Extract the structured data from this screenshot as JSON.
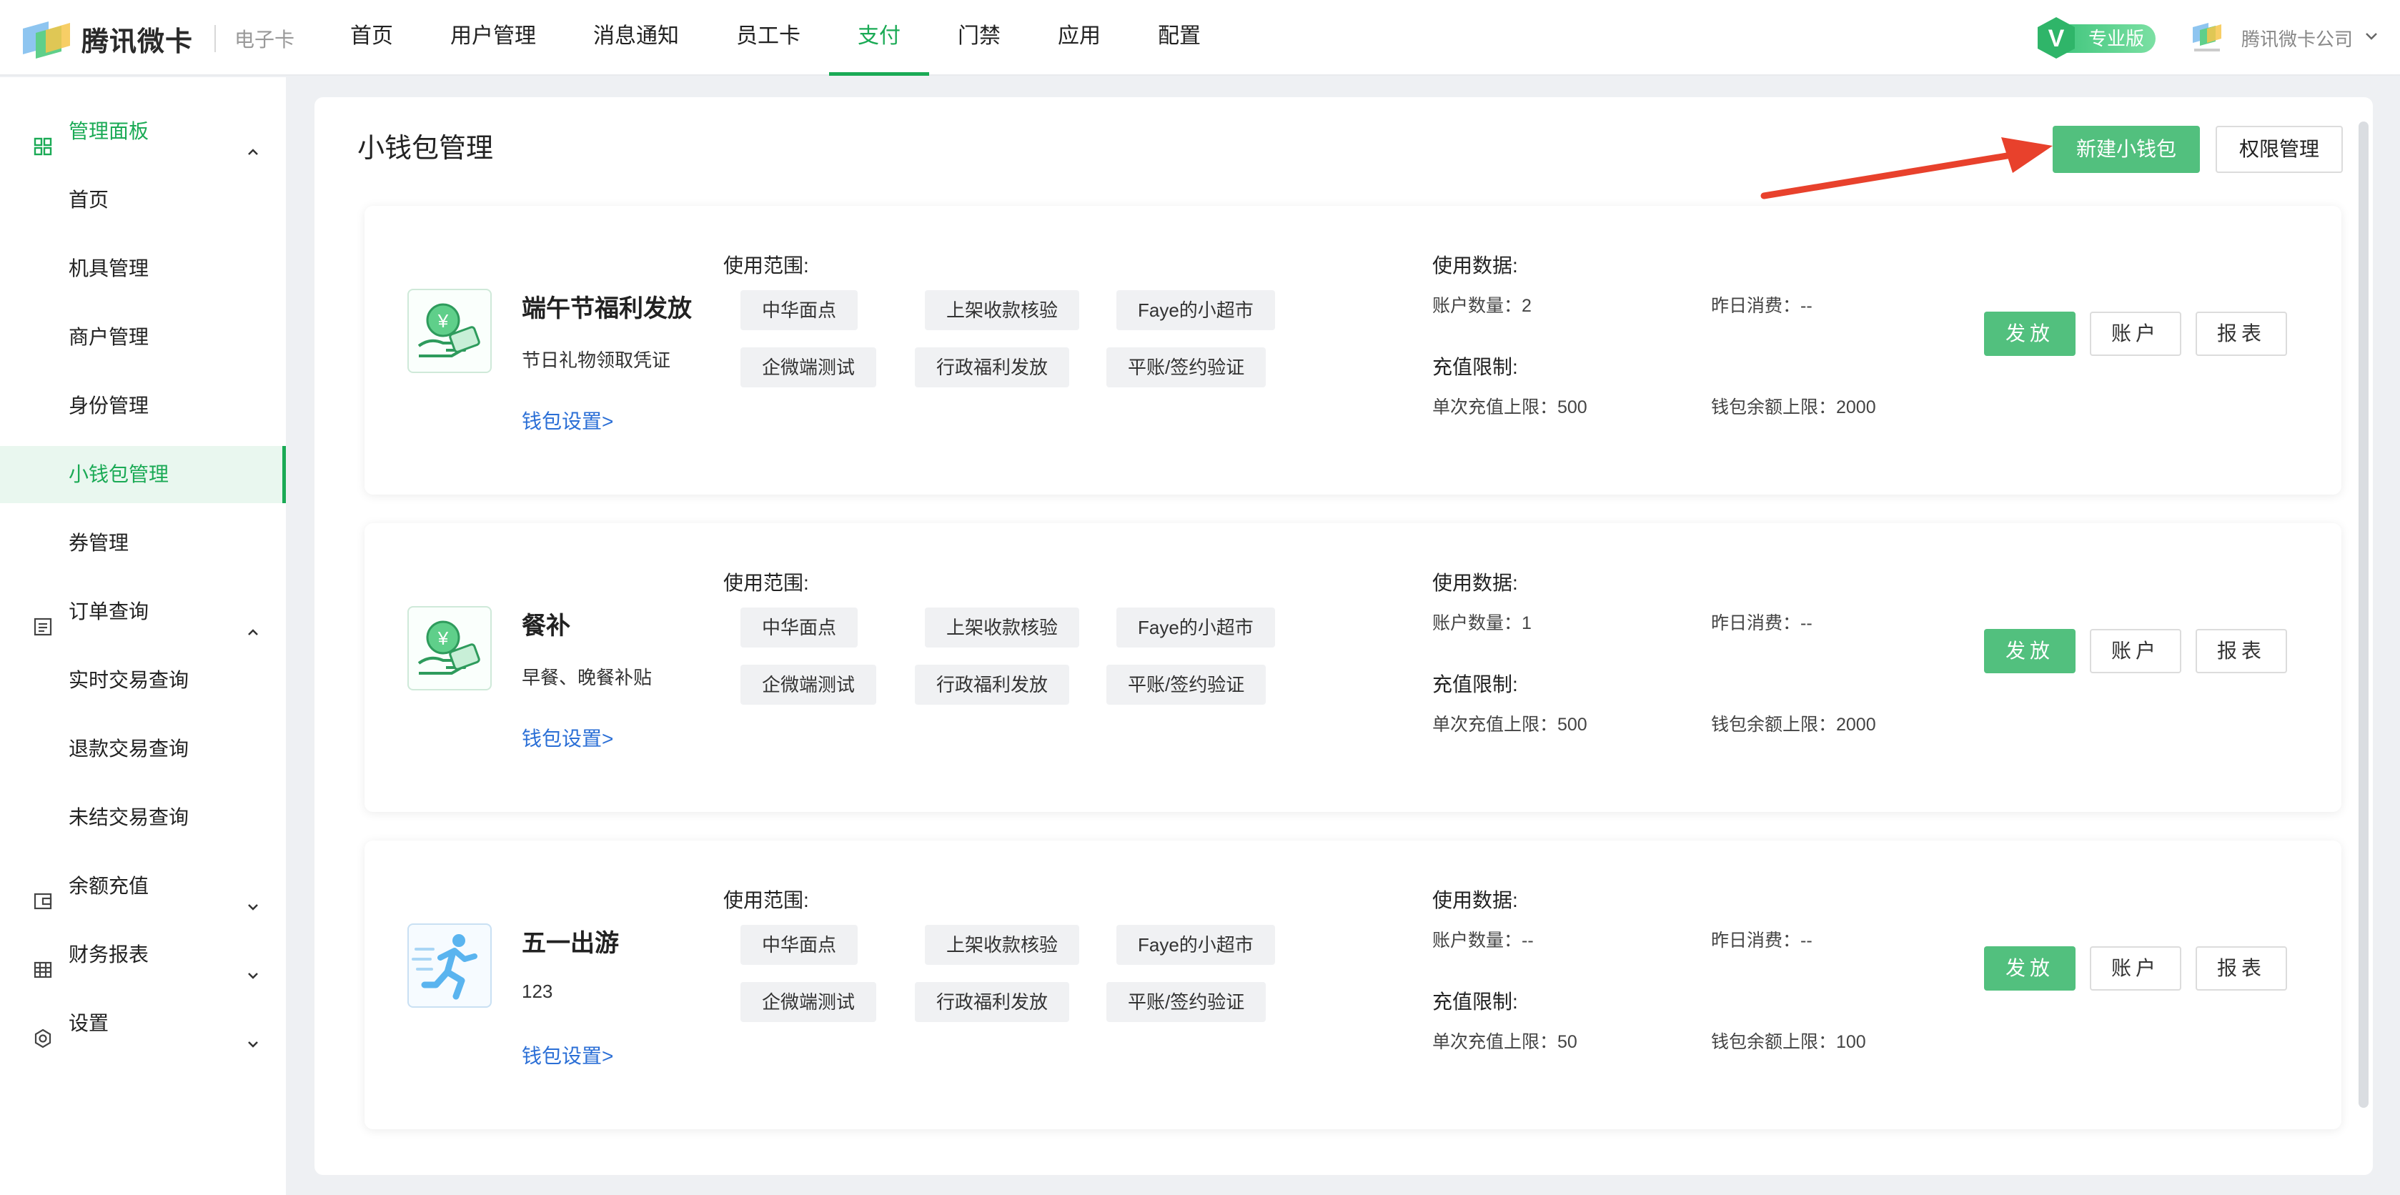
{
  "topbar": {
    "logo_text": "腾讯微卡",
    "logo_sub": "电子卡",
    "nav": [
      "首页",
      "用户管理",
      "消息通知",
      "员工卡",
      "支付",
      "门禁",
      "应用",
      "配置"
    ],
    "active_nav": "支付",
    "pro_label": "专业版",
    "pro_v": "V",
    "company": "腾讯微卡公司"
  },
  "sidebar": {
    "groups": [
      {
        "label": "管理面板",
        "icon": "grid-icon",
        "expanded": true,
        "items": [
          "首页",
          "机具管理",
          "商户管理",
          "身份管理",
          "小钱包管理",
          "券管理"
        ]
      },
      {
        "label": "订单查询",
        "icon": "list-icon",
        "expanded": true,
        "items": [
          "实时交易查询",
          "退款交易查询",
          "未结交易查询"
        ]
      },
      {
        "label": "余额充值",
        "icon": "wallet-icon",
        "expanded": false,
        "items": []
      },
      {
        "label": "财务报表",
        "icon": "table-icon",
        "expanded": false,
        "items": []
      },
      {
        "label": "设置",
        "icon": "gear-icon",
        "expanded": false,
        "items": []
      }
    ],
    "active_item": "小钱包管理"
  },
  "main": {
    "title": "小钱包管理",
    "new_button": "新建小钱包",
    "perm_button": "权限管理",
    "scope_label": "使用范围:",
    "data_label": "使用数据:",
    "limit_label": "充值限制:",
    "actions": {
      "issue": "发放",
      "account": "账户",
      "report": "报表"
    },
    "wallets": [
      {
        "name": "端午节福利发放",
        "desc": "节日礼物领取凭证",
        "link": "钱包设置>",
        "icon": "money-hand-icon",
        "scopes": [
          "中华面点",
          "上架收款核验",
          "Faye的小超市",
          "企微端测试",
          "行政福利发放",
          "平账/签约验证"
        ],
        "account_count": "账户数量：2",
        "yesterday": "昨日消费：--",
        "single_limit": "单次充值上限：500",
        "balance_limit": "钱包余额上限：2000"
      },
      {
        "name": "餐补",
        "desc": "早餐、晚餐补贴",
        "link": "钱包设置>",
        "icon": "money-hand-icon",
        "scopes": [
          "中华面点",
          "上架收款核验",
          "Faye的小超市",
          "企微端测试",
          "行政福利发放",
          "平账/签约验证"
        ],
        "account_count": "账户数量：1",
        "yesterday": "昨日消费：--",
        "single_limit": "单次充值上限：500",
        "balance_limit": "钱包余额上限：2000"
      },
      {
        "name": "五一出游",
        "desc": "123",
        "link": "钱包设置>",
        "icon": "runner-icon",
        "scopes": [
          "中华面点",
          "上架收款核验",
          "Faye的小超市",
          "企微端测试",
          "行政福利发放",
          "平账/签约验证"
        ],
        "account_count": "账户数量：--",
        "yesterday": "昨日消费：--",
        "single_limit": "单次充值上限：50",
        "balance_limit": "钱包余额上限：100"
      }
    ]
  },
  "colors": {
    "accent": "#52c07e",
    "active_nav": "#1aaa55",
    "link": "#2b6fd6",
    "arrow": "#e8412c"
  }
}
